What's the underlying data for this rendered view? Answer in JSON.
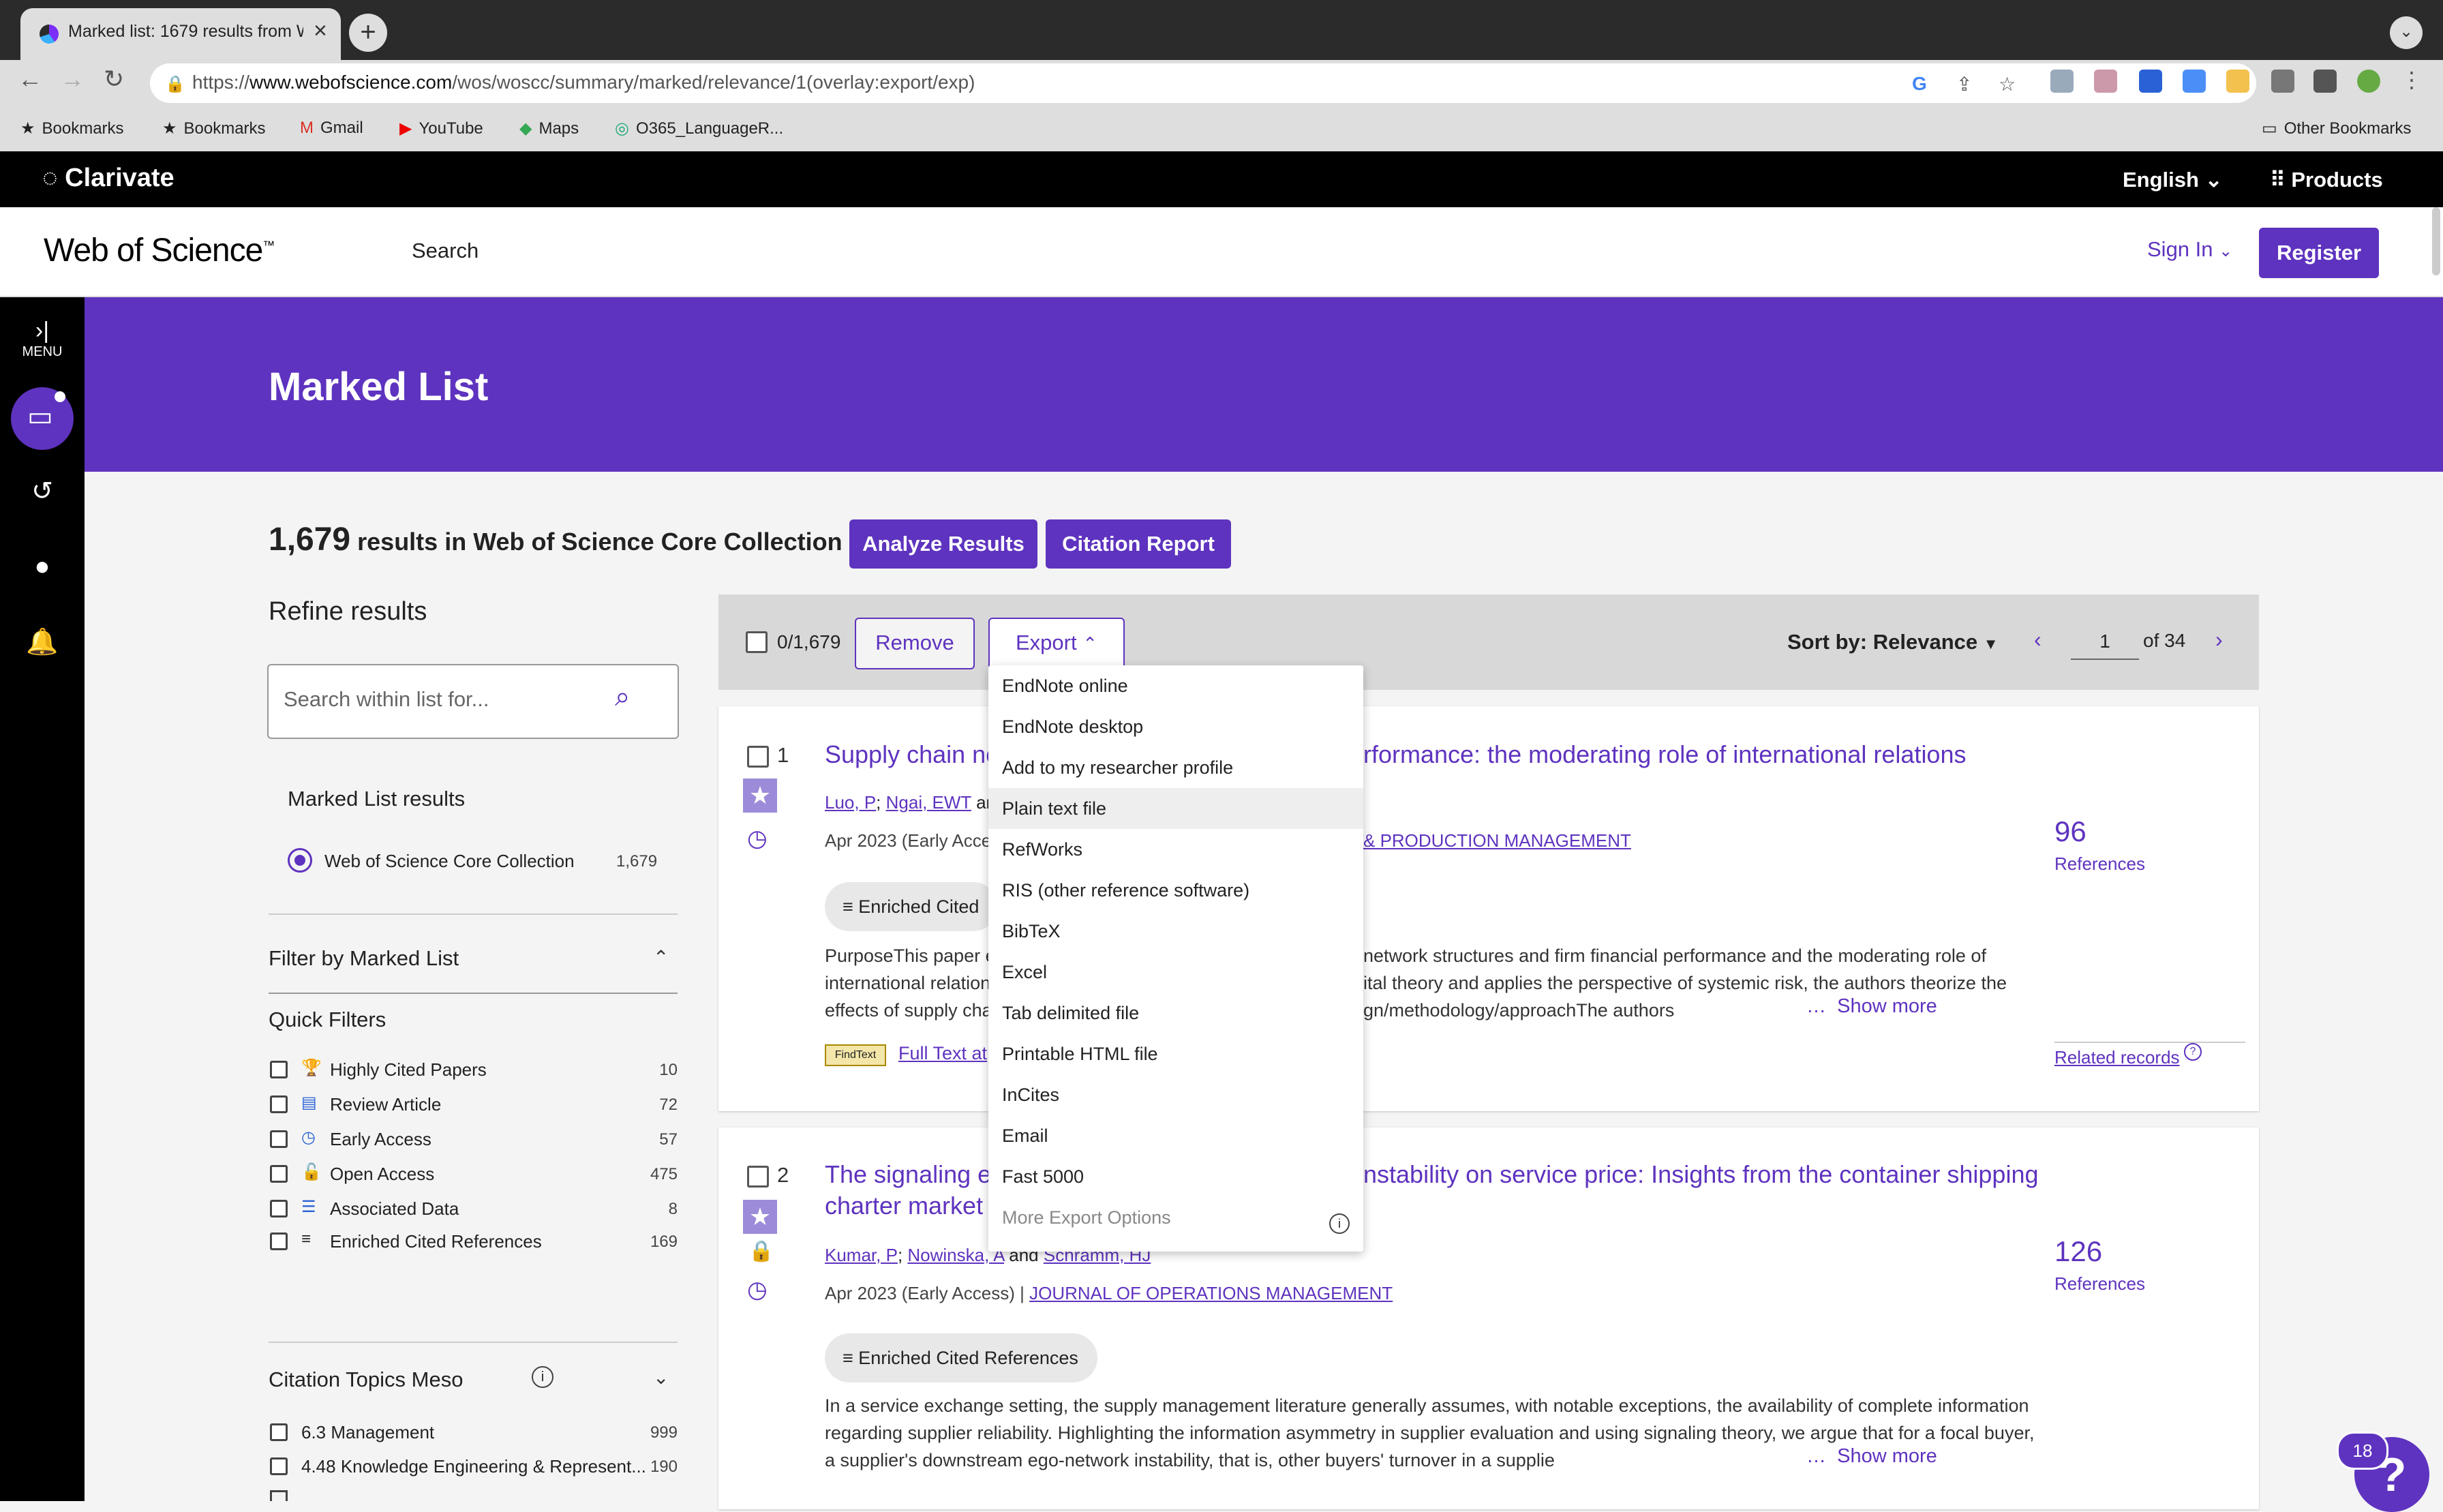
{
  "browser": {
    "tab_title": "Marked list: 1679 results from W",
    "url_host": "www.webofscience.com",
    "url_prefix": "https://",
    "url_path": "/wos/woscc/summary/marked/relevance/1(overlay:export/exp)",
    "bookmarks": [
      {
        "label": "Bookmarks",
        "icon": "star-icon"
      },
      {
        "label": "Bookmarks",
        "icon": "star-icon"
      },
      {
        "label": "Gmail",
        "icon": "gmail-icon"
      },
      {
        "label": "YouTube",
        "icon": "youtube-icon"
      },
      {
        "label": "Maps",
        "icon": "maps-icon"
      },
      {
        "label": "O365_LanguageR...",
        "icon": "globe-icon"
      }
    ],
    "other_bookmarks": "Other Bookmarks"
  },
  "header": {
    "brand": "Clarivate",
    "language": "English",
    "products": "Products",
    "product_name": "Web of Science",
    "search_link": "Search",
    "sign_in": "Sign In",
    "register": "Register"
  },
  "rail": {
    "menu_label": "MENU"
  },
  "banner": {
    "title": "Marked List"
  },
  "results": {
    "count": "1,679",
    "count_text": "results in Web of Science Core Collection",
    "analyze_button": "Analyze Results",
    "citation_button": "Citation Report",
    "selected": "0/1,679",
    "remove_button": "Remove",
    "export_button": "Export",
    "sort_by": "Sort by: Relevance",
    "page": "1",
    "page_of": "of 34"
  },
  "refine": {
    "title": "Refine results",
    "search_placeholder": "Search within list for...",
    "marked_results_label": "Marked List results",
    "collection": "Web of Science Core Collection",
    "collection_count": "1,679",
    "filter_title": "Filter by Marked List",
    "quick_filters_title": "Quick Filters",
    "quick_filters": [
      {
        "label": "Highly Cited Papers",
        "count": "10",
        "icon": "trophy-icon"
      },
      {
        "label": "Review Article",
        "count": "72",
        "icon": "document-icon"
      },
      {
        "label": "Early Access",
        "count": "57",
        "icon": "clock-icon"
      },
      {
        "label": "Open Access",
        "count": "475",
        "icon": "lock-open-icon"
      },
      {
        "label": "Associated Data",
        "count": "8",
        "icon": "database-icon"
      },
      {
        "label": "Enriched Cited References",
        "count": "169",
        "icon": "enriched-list-icon"
      }
    ],
    "citation_topics_title": "Citation Topics Meso",
    "citation_topics": [
      {
        "label": "6.3 Management",
        "count": "999"
      },
      {
        "label": "4.48 Knowledge Engineering & Represent...",
        "count": "190"
      }
    ]
  },
  "records": [
    {
      "index": "1",
      "title_visible_start": "Supply chain ne",
      "title_visible_end": "rformance: the moderating role of international relations",
      "authors": [
        "Luo, P",
        "Ngai, EWT"
      ],
      "authors_tail": "and",
      "meta_start": "Apr 2023 (Early Acces",
      "journal_tail": "& PRODUCTION MANAGEMENT",
      "enriched": "Enriched Cited",
      "abstract_left": [
        "PurposeThis paper e",
        "international relation",
        "effects of supply cha"
      ],
      "abstract_right": [
        "network structures and firm financial performance and the moderating role of",
        "ital theory and applies the perspective of systemic risk, the authors theorize the",
        "gn/methodology/approachThe authors"
      ],
      "show_more": "Show more",
      "fulltext": "Full Text at",
      "findtext": "FindText",
      "references_count": "96",
      "references_label": "References",
      "related": "Related records"
    },
    {
      "index": "2",
      "title_line1_start": "The signaling eff",
      "title_line1_end": "nstability on service price: Insights from the container shipping",
      "title_line2": "charter market",
      "authors": [
        "Kumar, P",
        "Nowinska, A",
        "Schramm, HJ"
      ],
      "meta": "Apr 2023 (Early Access) |",
      "journal": "JOURNAL OF OPERATIONS MANAGEMENT",
      "enriched": "Enriched Cited References",
      "abstract": [
        "In a service exchange setting, the supply management literature generally assumes, with notable exceptions, the availability of complete information",
        "regarding supplier reliability. Highlighting the information asymmetry in supplier evaluation and using signaling theory, we argue that for a focal buyer,",
        "a supplier's downstream ego-network instability, that is, other buyers' turnover in a supplie"
      ],
      "show_more": "Show more",
      "references_count": "126",
      "references_label": "References"
    }
  ],
  "export_menu": [
    "EndNote online",
    "EndNote desktop",
    "Add to my researcher profile",
    "Plain text file",
    "RefWorks",
    "RIS (other reference software)",
    "BibTeX",
    "Excel",
    "Tab delimited file",
    "Printable HTML file",
    "InCites",
    "Email",
    "Fast 5000",
    "More Export Options"
  ],
  "help": {
    "badge": "18",
    "glyph": "?"
  },
  "colors": {
    "accent": "#5e33bf",
    "black_bar": "#000000",
    "star": "#9c8bd9"
  }
}
